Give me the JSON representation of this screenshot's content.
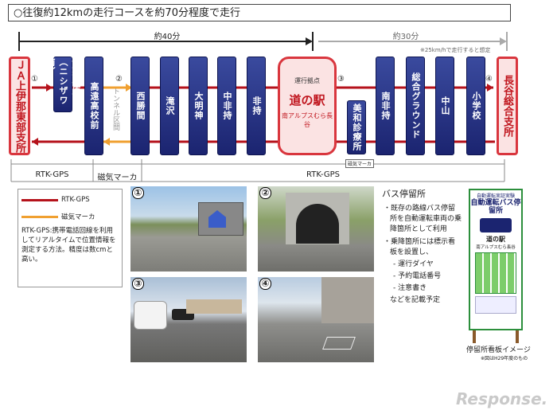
{
  "title": "○往復約12kmの走行コースを約70分程度で走行",
  "spans": {
    "left": "約40分",
    "right": "約30分",
    "right_note": "※25km/hで走行すると想定"
  },
  "stops": [
    {
      "label": "伊那小原（ニシザワ前）"
    },
    {
      "label": "高遠高校前"
    },
    {
      "label": "西勝間"
    },
    {
      "label": "滝沢"
    },
    {
      "label": "大明神"
    },
    {
      "label": "中非持"
    },
    {
      "label": "非持"
    },
    {
      "label": "美和診療所"
    },
    {
      "label": "南非持"
    },
    {
      "label": "総合グラウンド"
    },
    {
      "label": "中山"
    },
    {
      "label": "小学校"
    }
  ],
  "ends": {
    "left": "ＪＡ上伊那東部支所",
    "right": "長谷総合支所"
  },
  "hub": {
    "sub": "運行拠点",
    "main": "道の駅",
    "desc": "南アルプスむら長谷"
  },
  "tunnel": "トンネル区間",
  "circles": [
    "①",
    "②",
    "③",
    "④"
  ],
  "magnet_small": "磁気マーカ",
  "gps_bar": {
    "left": "RTK-GPS",
    "mid": "磁気マーカ",
    "right": "RTK-GPS"
  },
  "legend": {
    "gps": "RTK-GPS",
    "magnet": "磁気マーカ",
    "desc": "RTK-GPS:携帯電話回線を利用してリアルタイムで位置情報を測定する方法。精度は数cmと高い。"
  },
  "photos": [
    "①",
    "②",
    "③",
    "④"
  ],
  "bus": {
    "heading": "バス停留所",
    "b1": "既存の路線バス停留所を自動運転車両の乗降箇所として利用",
    "b2": "乗降箇所には標示看板を設置し、",
    "items": [
      "運行ダイヤ",
      "予約電話番号",
      "注意書き"
    ],
    "tail": "などを記載予定"
  },
  "sign": {
    "top": "自動運転実証実験",
    "title": "自動運転バス停留所",
    "name": "道の駅",
    "desc": "南アルプスむら長谷",
    "caption": "停留所看板イメージ",
    "caption_note": "※図はH29年度のもの"
  },
  "watermark": "Response.",
  "colors": {
    "route": "#b5121b",
    "magnet": "#f0a030",
    "stop": "#1b2470",
    "end": "#d9363e"
  }
}
